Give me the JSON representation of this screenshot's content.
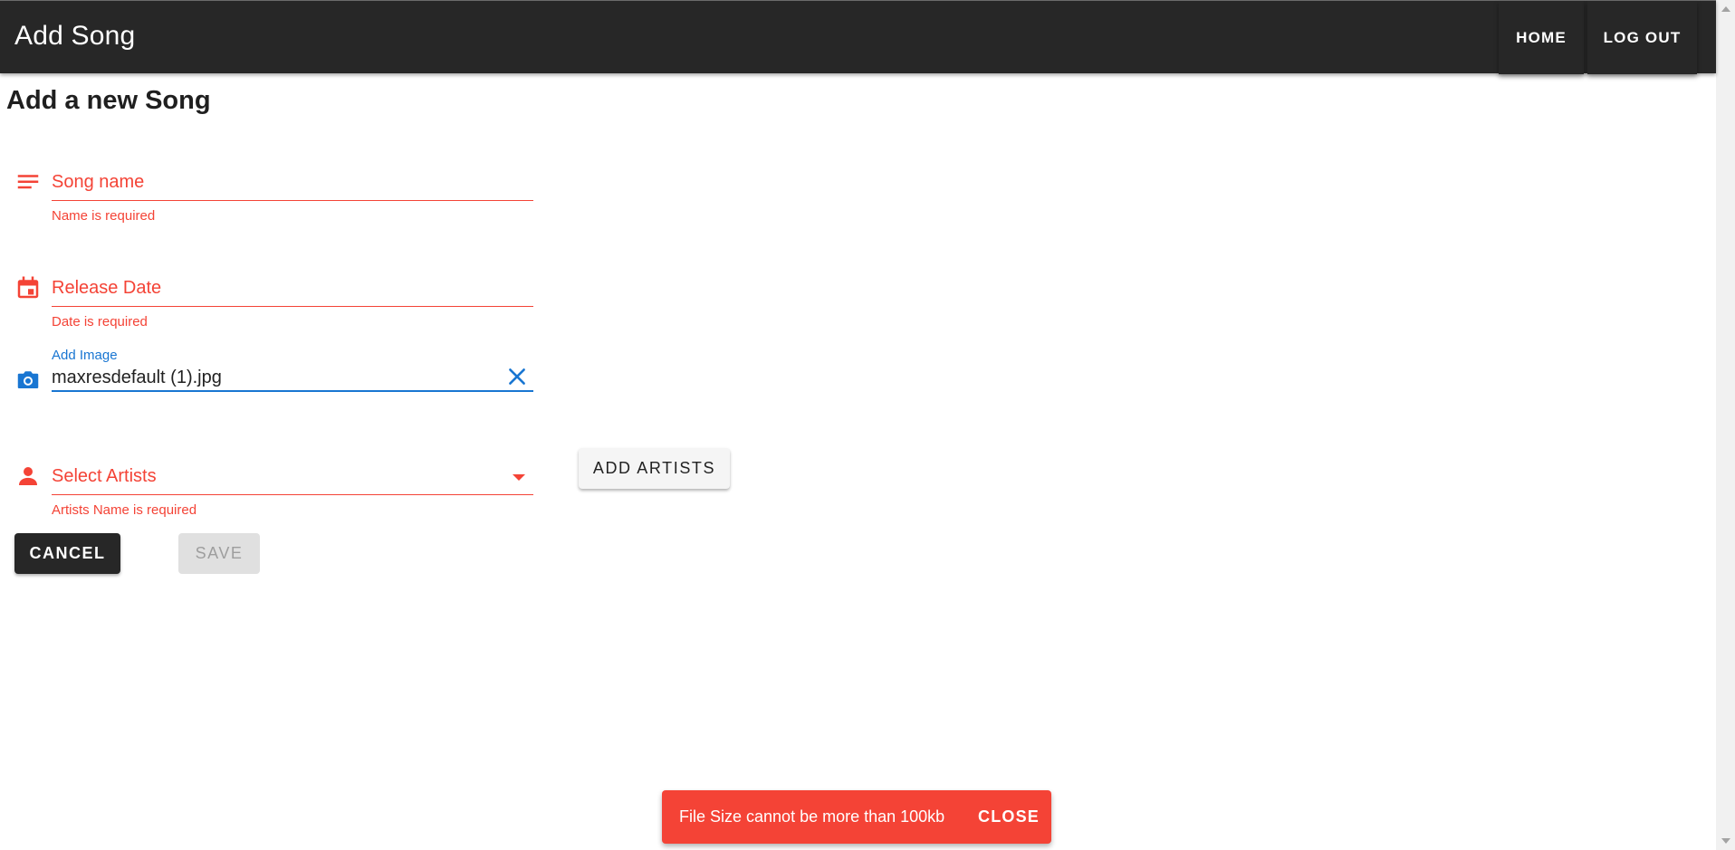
{
  "header": {
    "title": "Add Song",
    "nav": {
      "home_label": "HOME",
      "logout_label": "LOG OUT"
    }
  },
  "page": {
    "heading": "Add a new Song"
  },
  "form": {
    "song_name": {
      "label": "Song name",
      "error": "Name is required"
    },
    "release_date": {
      "label": "Release Date",
      "error": "Date is required"
    },
    "image": {
      "label": "Add Image",
      "value": "maxresdefault (1).jpg"
    },
    "artists": {
      "label": "Select Artists",
      "error": "Artists Name is required"
    },
    "add_artists_label": "ADD ARTISTS",
    "cancel_label": "CANCEL",
    "save_label": "SAVE"
  },
  "snackbar": {
    "message": "File Size cannot be more than 100kb",
    "close_label": "CLOSE"
  },
  "colors": {
    "app_bar": "#272727",
    "error": "#f44336",
    "primary": "#1976d2"
  }
}
